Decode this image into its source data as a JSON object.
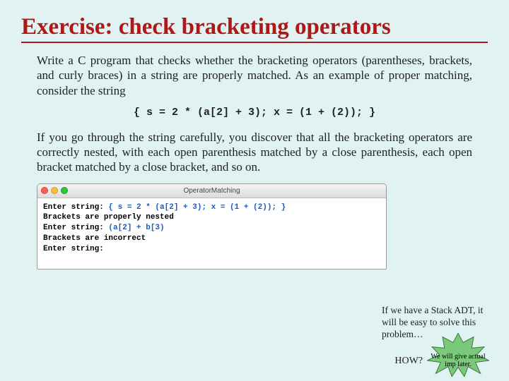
{
  "title": "Exercise: check bracketing operators",
  "para1": "Write a C program that checks whether the bracketing operators (parentheses, brackets, and curly braces) in a string are properly matched.  As an example of proper matching, consider the string",
  "code_example": "{ s = 2 * (a[2] + 3); x = (1 + (2)); }",
  "para2": "If you go through the string carefully, you discover that all the bracketing operators are correctly nested, with each open parenthesis matched by a close parenthesis, each open bracket matched by a close bracket, and so on.",
  "window": {
    "title": "OperatorMatching",
    "lines": [
      {
        "prompt": "Enter string: ",
        "input": "{ s = 2 * (a[2] + 3); x = (1 + (2)); }"
      },
      {
        "prompt": "Brackets are properly nested",
        "input": ""
      },
      {
        "prompt": "Enter string: ",
        "input": "(a[2] + b[3)"
      },
      {
        "prompt": "Brackets are incorrect",
        "input": ""
      },
      {
        "prompt": "Enter string:",
        "input": ""
      }
    ]
  },
  "sidenote": "If we have a Stack ADT, it will be easy to solve this problem…",
  "how_label": "HOW?",
  "burst_text": "We will give actual imp later."
}
